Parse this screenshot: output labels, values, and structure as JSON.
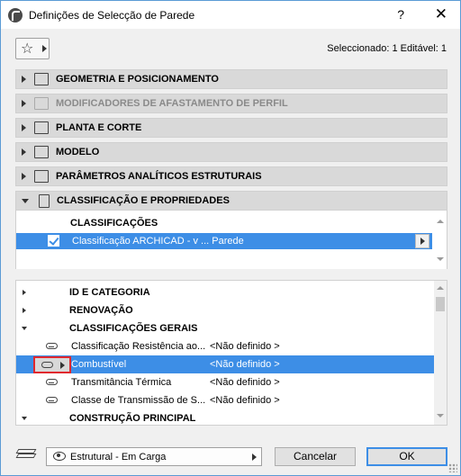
{
  "window": {
    "title": "Definições de Selecção de Parede",
    "help": "?",
    "close": "✕"
  },
  "header": {
    "selection_info": "Seleccionado: 1 Editável: 1"
  },
  "sections": [
    {
      "label": "GEOMETRIA E POSICIONAMENTO",
      "expanded": false,
      "disabled": false
    },
    {
      "label": "MODIFICADORES DE AFASTAMENTO DE PERFIL",
      "expanded": false,
      "disabled": true
    },
    {
      "label": "PLANTA E CORTE",
      "expanded": false,
      "disabled": false
    },
    {
      "label": "MODELO",
      "expanded": false,
      "disabled": false
    },
    {
      "label": "PARÂMETROS ANALÍTICOS ESTRUTURAIS",
      "expanded": false,
      "disabled": false
    },
    {
      "label": "CLASSIFICAÇÃO E PROPRIEDADES",
      "expanded": true,
      "disabled": false
    }
  ],
  "classifications": {
    "header": "CLASSIFICAÇÕES",
    "row_text": "Classificação ARCHICAD - v ... Parede",
    "checked": true
  },
  "properties": {
    "rows": [
      {
        "type": "group",
        "label": "ID E CATEGORIA",
        "expanded": false
      },
      {
        "type": "group",
        "label": "RENOVAÇÃO",
        "expanded": false
      },
      {
        "type": "group",
        "label": "CLASSIFICAÇÕES GERAIS",
        "expanded": true
      },
      {
        "type": "prop",
        "name": "Classificação Resistência ao...",
        "value": "<Não definido >"
      },
      {
        "type": "prop",
        "name": "Combustível",
        "value": "<Não definido >",
        "selected": true
      },
      {
        "type": "prop",
        "name": "Transmitância Térmica",
        "value": "<Não definido >"
      },
      {
        "type": "prop",
        "name": "Classe de Transmissão de S...",
        "value": "<Não definido >"
      },
      {
        "type": "group",
        "label": "CONSTRUÇÃO PRINCIPAL",
        "expanded": true
      }
    ]
  },
  "footer": {
    "view_option": "Estrutural - Em Carga",
    "cancel_label": "Cancelar",
    "ok_label": "OK"
  },
  "colors": {
    "selection": "#3d8ee6",
    "highlight_box": "#e0282e",
    "section_bg": "#d9d9d9"
  }
}
